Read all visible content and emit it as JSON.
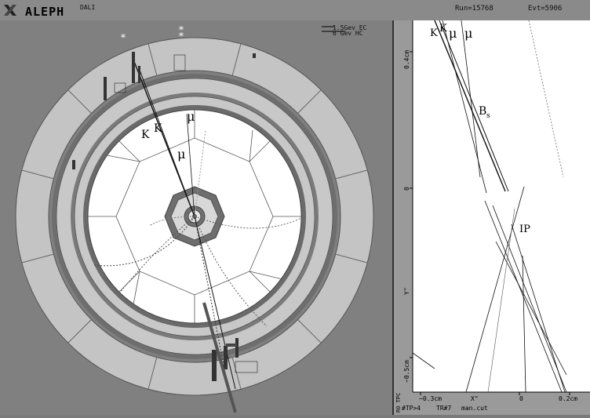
{
  "header": {
    "app_title": "ALEPH",
    "subtitle": "DALI",
    "run": "Run=15768",
    "event": "Evt=5906",
    "logo_icon": "aleph-logo-icon"
  },
  "legend": {
    "ec_scale": "1.5Gev EC",
    "hc_scale": "6  Gev HC"
  },
  "left_view": {
    "labels": {
      "kaon_1": "K",
      "kaon_2": "K",
      "muon_1": "μ",
      "muon_2": "μ",
      "star_1": "*",
      "star_2": "*",
      "star_3": "*"
    }
  },
  "right_view": {
    "labels": {
      "kaon_1": "K",
      "kaon_2": "K",
      "muon_1": "μ",
      "muon_2": "μ",
      "bs": "B",
      "bs_sub": "s",
      "ip": "IP"
    },
    "y_axis": {
      "ticks": [
        "0.4cm",
        "0",
        "−0.5cm"
      ],
      "label": "Y\""
    },
    "x_axis": {
      "ticks": [
        "−0.3cm",
        "0",
        "0.2cm"
      ],
      "label": "X\""
    },
    "footer": {
      "corner": "RO TPC",
      "tp": "#TP>4",
      "tr": "TR#7",
      "cut": "man.cut"
    }
  },
  "colors": {
    "background": "#808080",
    "ring_light": "#c8c8c8",
    "ring_dark": "#6e6e6e",
    "inner": "#ffffff"
  }
}
